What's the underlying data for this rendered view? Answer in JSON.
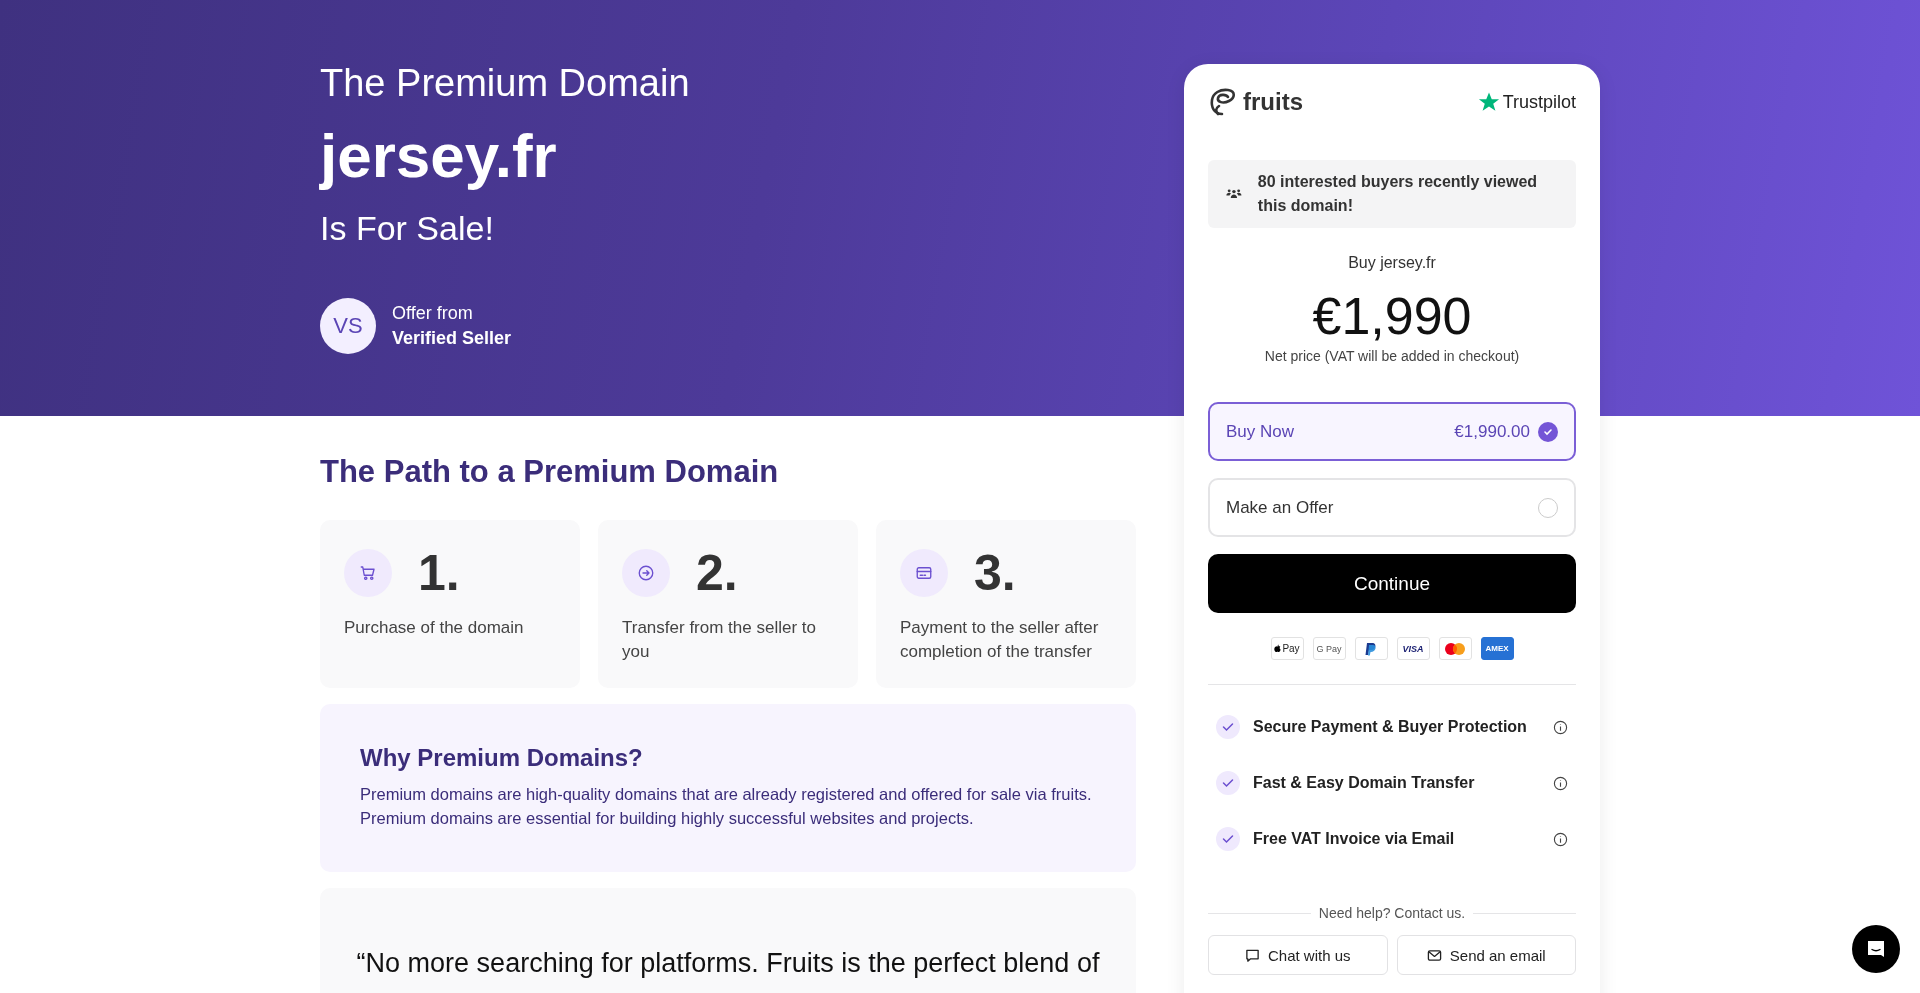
{
  "hero": {
    "title": "The Premium Domain",
    "domain": "jersey.fr",
    "subtitle": "Is For Sale!",
    "seller": {
      "initials": "VS",
      "caption": "Offer from",
      "name": "Verified Seller"
    }
  },
  "path": {
    "heading": "The Path to a Premium Domain",
    "steps": [
      {
        "kind": "cart",
        "number": "1.",
        "text": "Purchase of the domain"
      },
      {
        "kind": "transfer",
        "number": "2.",
        "text": "Transfer from the seller to you"
      },
      {
        "kind": "payment",
        "number": "3.",
        "text": "Payment to the seller after completion of the transfer"
      }
    ]
  },
  "why": {
    "heading": "Why Premium Domains?",
    "text": "Premium domains are high-quality domains that are already registered and offered for sale via fruits. Premium domains are essential for building highly successful websites and projects."
  },
  "quote": {
    "text": "“No more searching for platforms. Fruits is the perfect blend of"
  },
  "card": {
    "logo": "fruits",
    "rating_site": "Trustpilot",
    "notice": "80 interested buyers recently viewed this domain!",
    "buy_label": "Buy jersey.fr",
    "price": "€1,990",
    "price_note": "Net price (VAT will be added in checkout)",
    "options": [
      {
        "label": "Buy Now",
        "price": "€1,990.00",
        "selected": true
      },
      {
        "label": "Make an Offer",
        "selected": false
      }
    ],
    "continue": "Continue",
    "payment_methods": [
      {
        "kind": "applepay",
        "label": "Pay"
      },
      {
        "kind": "gpay",
        "label": "G Pay"
      },
      {
        "kind": "paypal"
      },
      {
        "kind": "visa",
        "label": "VISA"
      },
      {
        "kind": "mastercard"
      },
      {
        "kind": "amex",
        "label": "AMEX"
      }
    ],
    "features": [
      "Secure Payment & Buyer Protection",
      "Fast & Easy Domain Transfer",
      "Free VAT Invoice via Email"
    ],
    "help": "Need help? Contact us.",
    "contacts": [
      {
        "kind": "chat",
        "label": "Chat with us"
      },
      {
        "kind": "email",
        "label": "Send an email"
      }
    ]
  }
}
